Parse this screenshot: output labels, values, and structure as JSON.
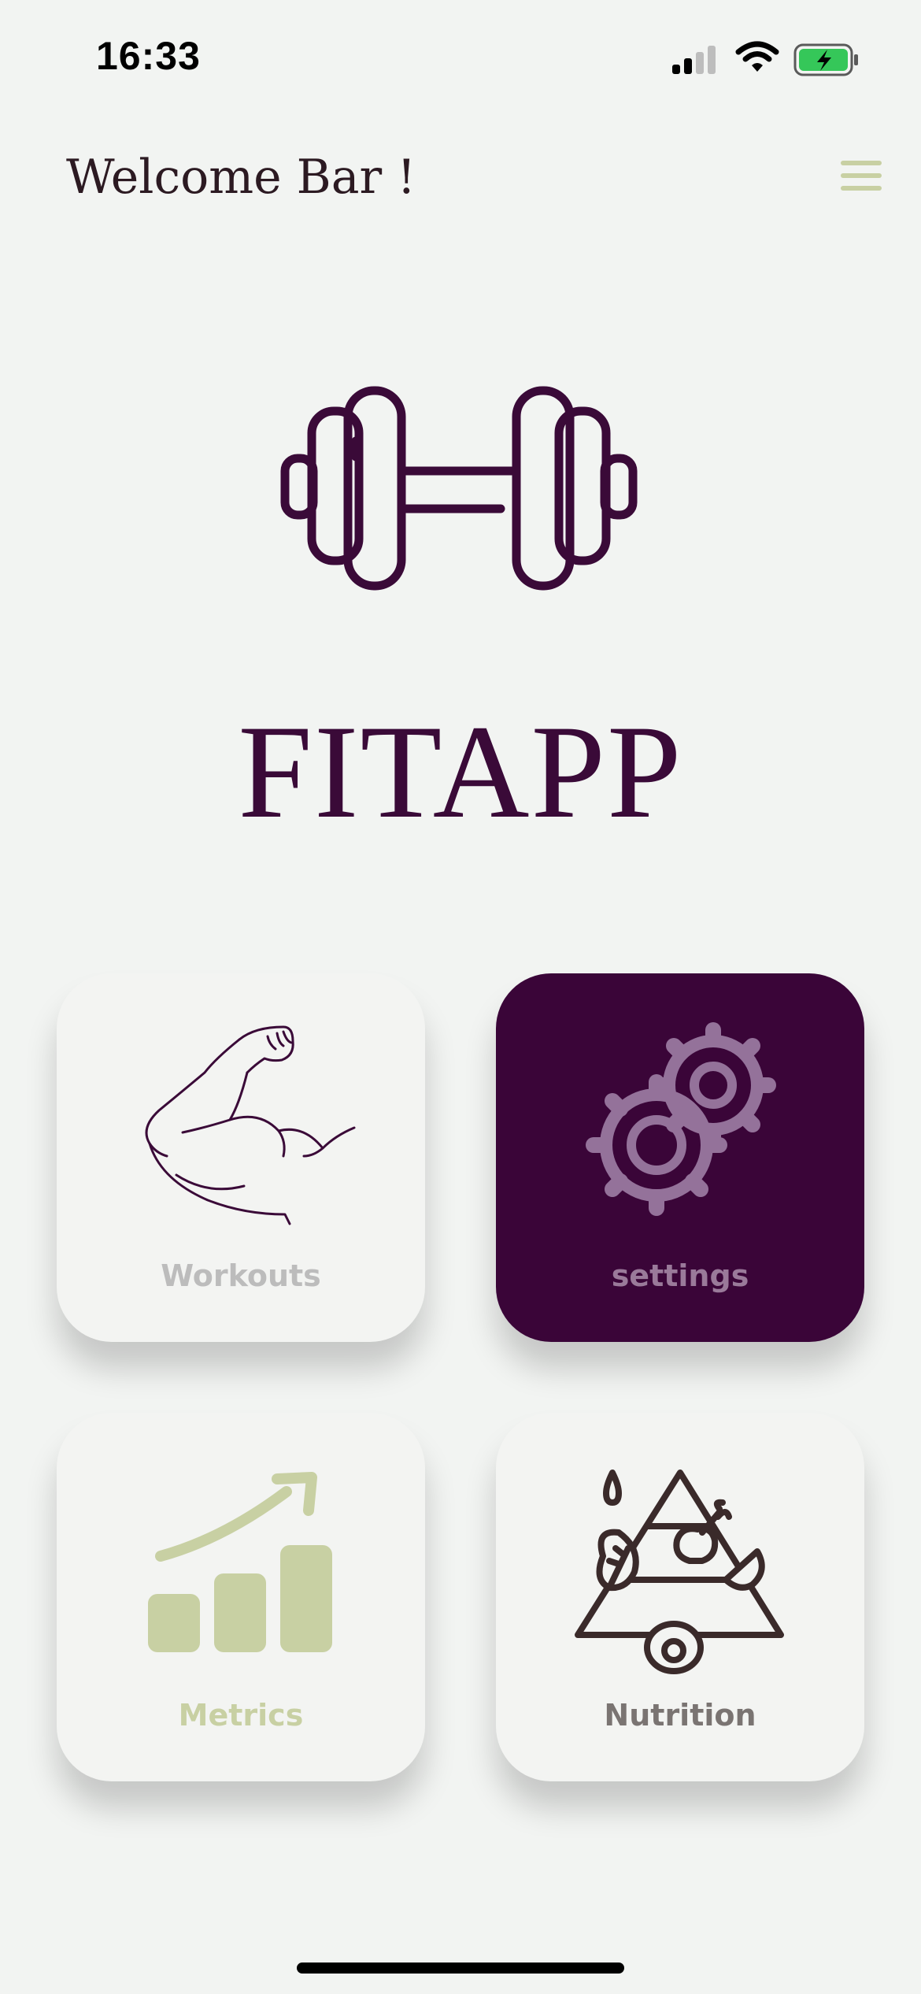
{
  "status_bar": {
    "time": "16:33",
    "icons": [
      "cellular-signal-icon",
      "wifi-icon",
      "battery-charging-icon"
    ]
  },
  "header": {
    "welcome_text": "Welcome Bar !",
    "menu_icon": "hamburger-menu-icon"
  },
  "logo": {
    "icon": "dumbbell-icon",
    "app_name": "FITAPP"
  },
  "tiles": [
    {
      "label": "Workouts",
      "icon": "flexed-arm-icon",
      "label_color": "#bcbcbc",
      "background": "#f3f4f2"
    },
    {
      "label": "settings",
      "icon": "gears-icon",
      "label_color": "#9a7a9a",
      "background": "#3a0538"
    },
    {
      "label": "Metrics",
      "icon": "growth-chart-icon",
      "label_color": "#c8d0a3",
      "background": "#f3f4f2"
    },
    {
      "label": "Nutrition",
      "icon": "food-pyramid-icon",
      "label_color": "#7a7472",
      "background": "#f3f4f2"
    }
  ],
  "colors": {
    "background": "#f2f4f2",
    "brand_purple": "#3a0a38",
    "accent_green": "#c8d0a3"
  }
}
